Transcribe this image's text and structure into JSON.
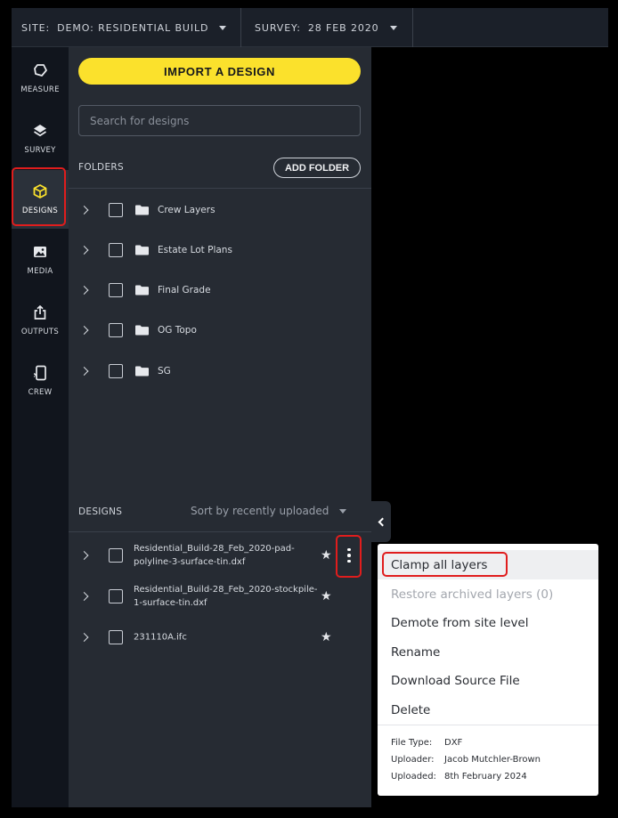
{
  "topbar": {
    "site_label": "SITE:",
    "site_value": "DEMO: RESIDENTIAL BUILD",
    "survey_label": "SURVEY:",
    "survey_value": "28 FEB 2020"
  },
  "rail": {
    "items": [
      {
        "label": "MEASURE",
        "icon": "measure-icon"
      },
      {
        "label": "SURVEY",
        "icon": "layers-icon"
      },
      {
        "label": "DESIGNS",
        "icon": "cube-icon",
        "active": true
      },
      {
        "label": "MEDIA",
        "icon": "image-icon"
      },
      {
        "label": "OUTPUTS",
        "icon": "share-icon"
      },
      {
        "label": "CREW",
        "icon": "device-icon"
      }
    ]
  },
  "panel": {
    "import_label": "IMPORT A DESIGN",
    "search_placeholder": "Search for designs",
    "folders_label": "FOLDERS",
    "add_folder_label": "ADD FOLDER",
    "folders": [
      {
        "name": "Crew Layers"
      },
      {
        "name": "Estate Lot Plans"
      },
      {
        "name": "Final Grade"
      },
      {
        "name": "OG Topo"
      },
      {
        "name": "SG"
      }
    ],
    "designs_label": "DESIGNS",
    "sort_label": "Sort by recently uploaded",
    "designs": [
      {
        "name": "Residential_Build-28_Feb_2020-pad-polyline-3-surface-tin.dxf"
      },
      {
        "name": "Residential_Build-28_Feb_2020-stockpile-1-surface-tin.dxf"
      },
      {
        "name": "231110A.ifc"
      }
    ]
  },
  "menu": {
    "items": [
      {
        "label": "Clamp all layers",
        "state": "hover"
      },
      {
        "label": "Restore archived layers (0)",
        "state": "disabled"
      },
      {
        "label": "Demote from site level"
      },
      {
        "label": "Rename"
      },
      {
        "label": "Download Source File"
      },
      {
        "label": "Delete"
      }
    ],
    "meta": {
      "file_type_label": "File Type:",
      "file_type": "DXF",
      "uploader_label": "Uploader:",
      "uploader": "Jacob Mutchler-Brown",
      "uploaded_label": "Uploaded:",
      "uploaded": "8th February 2024"
    }
  },
  "colors": {
    "accent": "#fbe12c",
    "panel_bg": "#262b33",
    "rail_bg": "#11151d",
    "annotation": "#e01d1d"
  }
}
